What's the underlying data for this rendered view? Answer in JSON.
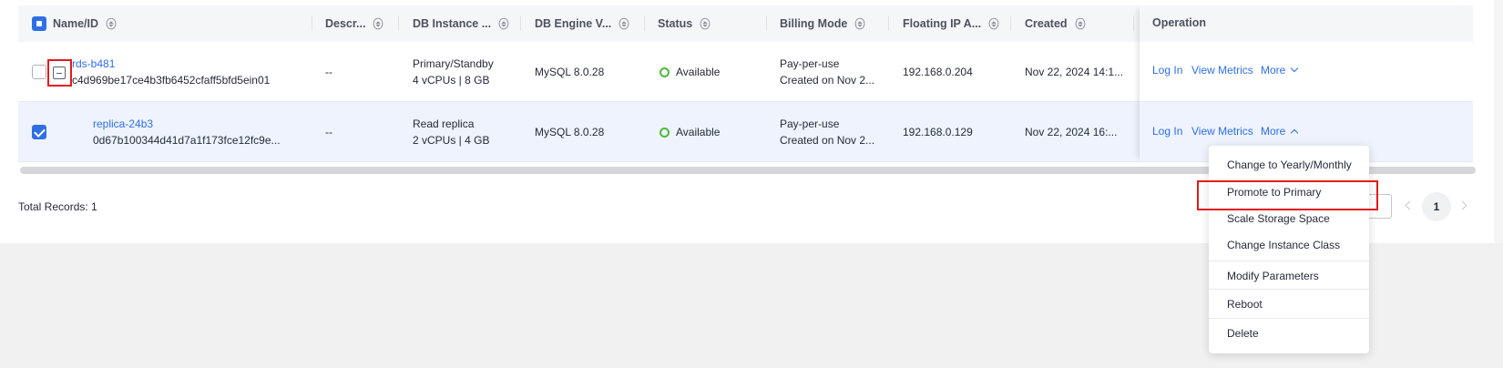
{
  "table": {
    "headers": [
      "Name/ID",
      "Descr...",
      "DB Instance ...",
      "DB Engine V...",
      "Status",
      "Billing Mode",
      "Floating IP A...",
      "Created",
      "Operation"
    ],
    "rows": [
      {
        "name": "rds-b481",
        "id": "c4d969be17ce4b3fb6452cfaff5bfd5ein01",
        "description": "--",
        "instance_type": "Primary/Standby",
        "instance_spec": "4 vCPUs | 8 GB",
        "engine": "MySQL 8.0.28",
        "status": "Available",
        "billing": "Pay-per-use",
        "billing_created": "Created on Nov 2...",
        "ip": "192.168.0.204",
        "created": "Nov 22, 2024 14:1...",
        "op_login": "Log In",
        "op_metrics": "View Metrics",
        "op_more": "More",
        "checked": false
      },
      {
        "name": "replica-24b3",
        "id": "0d67b100344d41d7a1f173fce12fc9e...",
        "description": "--",
        "instance_type": "Read replica",
        "instance_spec": "2 vCPUs | 4 GB",
        "engine": "MySQL 8.0.28",
        "status": "Available",
        "billing": "Pay-per-use",
        "billing_created": "Created on Nov 2...",
        "ip": "192.168.0.129",
        "created": "Nov 22, 2024 16:...",
        "op_login": "Log In",
        "op_metrics": "View Metrics",
        "op_more": "More",
        "checked": true
      }
    ]
  },
  "footer": {
    "total_records": "Total Records: 1",
    "current_page": "1"
  },
  "more_menu": {
    "items": [
      "Change to Yearly/Monthly",
      "Promote to Primary",
      "Scale Storage Space",
      "Change Instance Class",
      "Modify Parameters",
      "Reboot",
      "Delete"
    ],
    "highlighted": "Promote to Primary"
  },
  "colors": {
    "accent": "#2e6fe6",
    "status_ok": "#50b83c",
    "highlight_box": "#e31b1b",
    "selected_row": "#eef3fd"
  }
}
